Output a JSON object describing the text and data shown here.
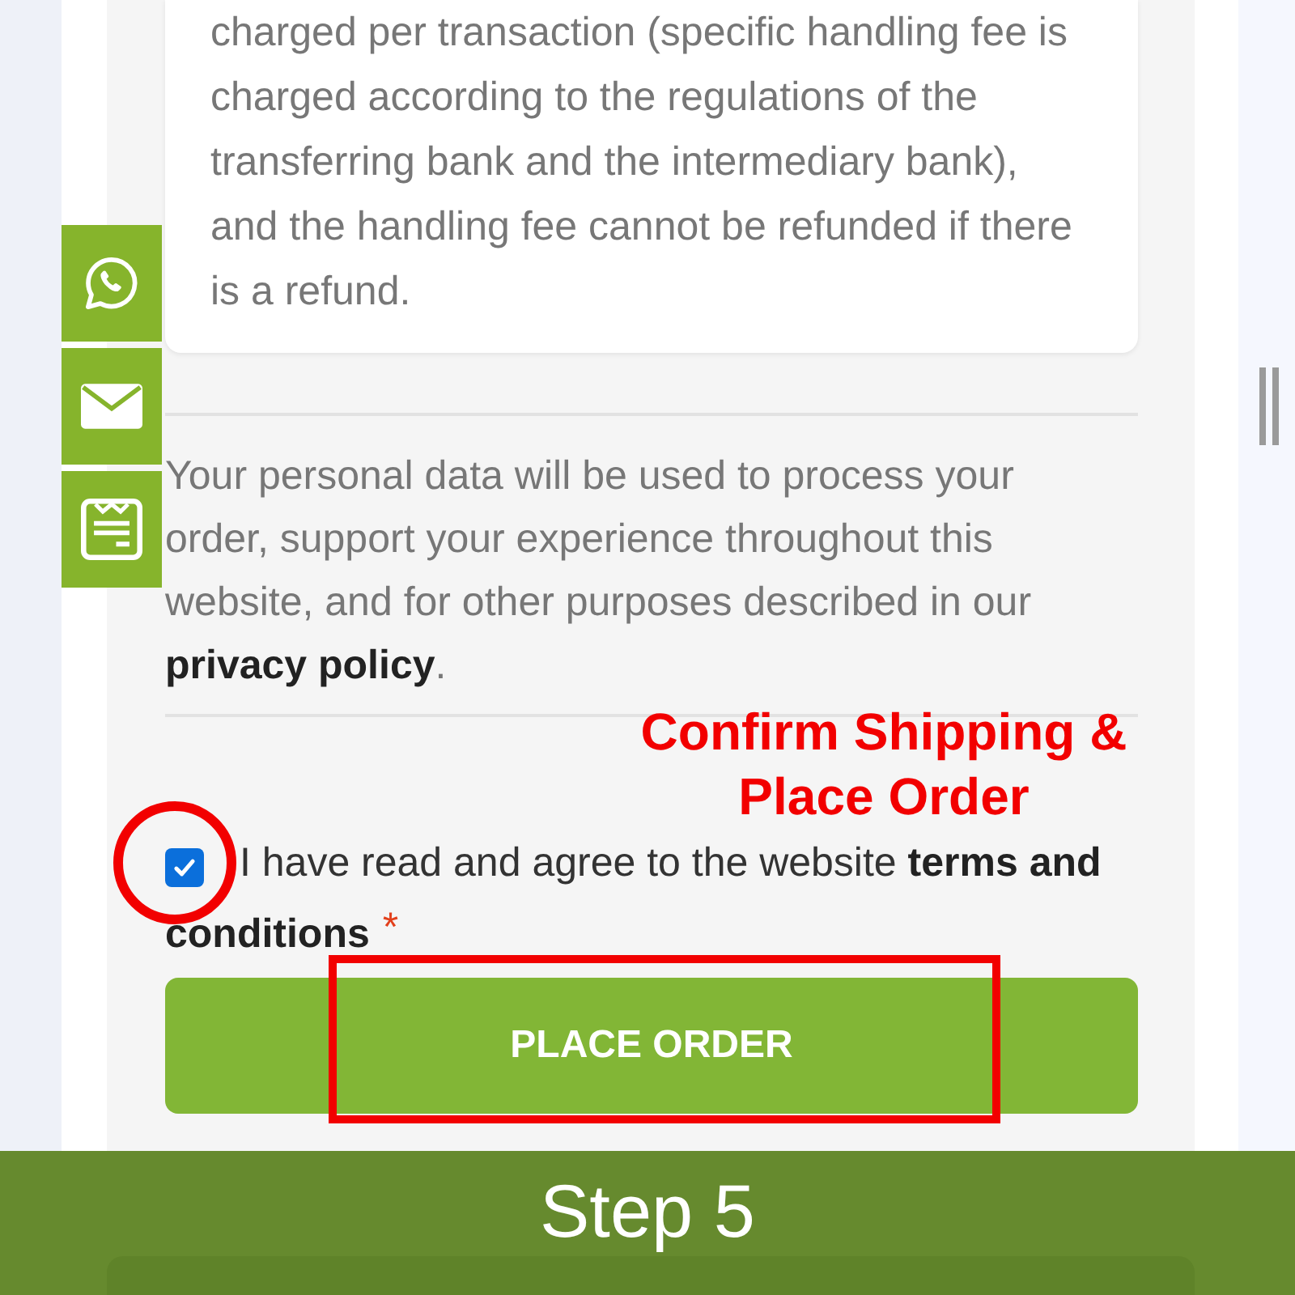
{
  "payment_note": {
    "lines": [
      "charged per transaction (specific handling fee is",
      "charged according to the regulations of the",
      "transferring bank and the intermediary bank),",
      "and the handling fee cannot be refunded if there",
      "is a refund."
    ]
  },
  "privacy_notice": {
    "lines": [
      "Your personal data will be used to process your",
      "order, support your experience throughout this",
      "website, and for other purposes described in our"
    ],
    "link": "privacy policy",
    "end": "."
  },
  "terms": {
    "checked": true,
    "label": "I have read and agree to the website **terms and conditions**",
    "required_mark": "*"
  },
  "place_order_button": {
    "label": "PLACE ORDER"
  },
  "annotation": {
    "lines": [
      "Confirm Shipping &",
      "Place Order"
    ]
  },
  "step_banner": {
    "title": "Step 5"
  }
}
